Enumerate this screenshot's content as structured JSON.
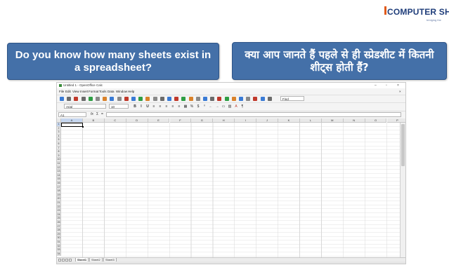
{
  "logo": {
    "text": "COMPUTER SHI",
    "tagline": "bridging the"
  },
  "questions": {
    "english": "Do you know how many sheets exist in a spreadsheet?",
    "hindi": "क्या आप जानते हैं पहले से ही स्प्रेडशीट में कितनी शीट्स होती हैं?"
  },
  "app": {
    "window_title": "Untitled 1 - OpenOffice Calc",
    "controls": {
      "minimize": "–",
      "maximize": "▫",
      "close": "×"
    },
    "menu": [
      "File",
      "Edit",
      "View",
      "Insert",
      "Format",
      "Tools",
      "Data",
      "Window",
      "Help"
    ],
    "font_name": "Arial",
    "font_size": "10",
    "find_placeholder": "Find",
    "name_box": "A1",
    "formula_icons": {
      "fx": "fx",
      "sum": "Σ",
      "equals": "="
    },
    "columns": [
      "A",
      "B",
      "C",
      "D",
      "E",
      "F",
      "G",
      "H",
      "I",
      "J",
      "K",
      "L",
      "M",
      "N",
      "O",
      "P"
    ],
    "rows": [
      "1",
      "2",
      "3",
      "4",
      "5",
      "6",
      "7",
      "8",
      "9",
      "10",
      "11",
      "12",
      "13",
      "14",
      "15",
      "16",
      "17",
      "18",
      "19",
      "20",
      "21",
      "22",
      "23",
      "24",
      "25",
      "26",
      "27",
      "28",
      "29",
      "30",
      "31",
      "32",
      "33",
      "34"
    ],
    "sheets": [
      "Sheet1",
      "Sheet2",
      "Sheet3"
    ],
    "active_sheet": "Sheet1",
    "active_cell": "A1"
  }
}
